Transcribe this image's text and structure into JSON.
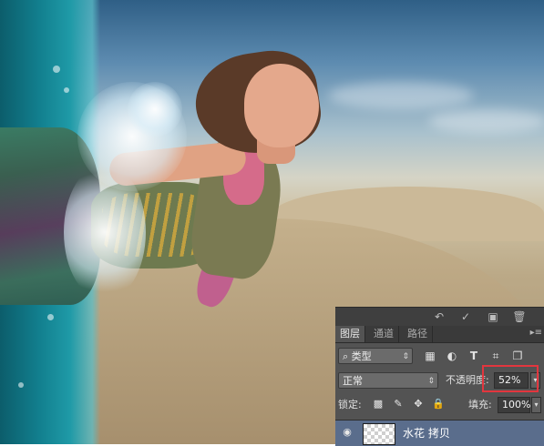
{
  "colors": {
    "highlight_box": "#e2363e",
    "selected_layer_bg": "#5a6d8c",
    "panel_bg": "#535353"
  },
  "panel": {
    "toolbar_icons": [
      "undo-icon",
      "checkmark-icon",
      "new-doc-icon",
      "trash-icon"
    ],
    "tabs": [
      {
        "label": "图层",
        "active": true
      },
      {
        "label": "通道",
        "active": false
      },
      {
        "label": "路径",
        "active": false
      }
    ],
    "filter": {
      "search_glyph": "⌕",
      "kind_label": "类型",
      "filter_icons": [
        "image-filter-icon",
        "adjustment-filter-icon",
        "type-filter-icon",
        "shape-filter-icon",
        "smart-object-filter-icon"
      ]
    },
    "blend": {
      "mode": "正常",
      "opacity_label": "不透明度:",
      "opacity_value": "52%"
    },
    "lock": {
      "label": "锁定:",
      "fill_label": "填充:",
      "fill_value": "100%"
    },
    "layer": {
      "name": "水花 拷贝",
      "visible": true,
      "selected": true
    }
  }
}
